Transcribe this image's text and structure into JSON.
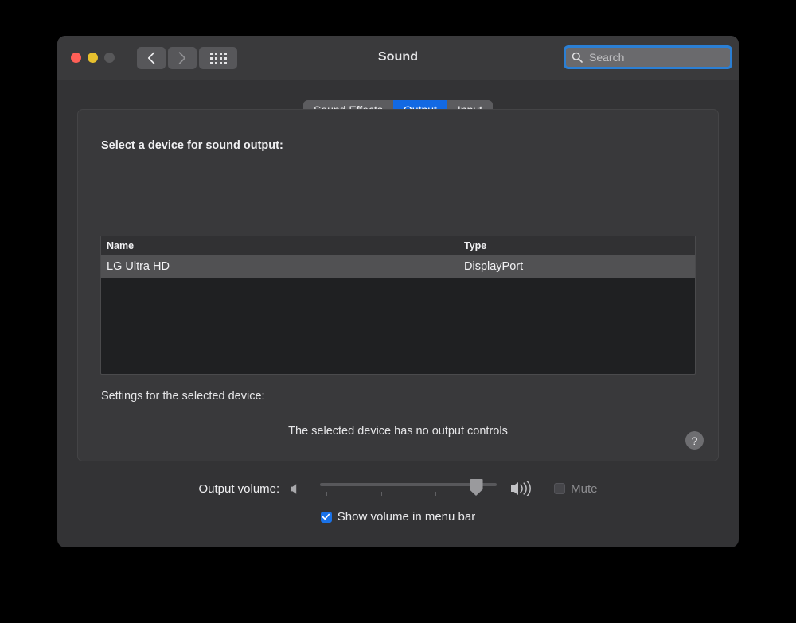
{
  "window": {
    "title": "Sound",
    "traffic_lights": [
      "close",
      "minimize",
      "zoom"
    ],
    "nav": {
      "back": "back-chevron",
      "forward": "forward-chevron",
      "grid": "show-all-grid"
    },
    "search": {
      "placeholder": "Search",
      "value": ""
    }
  },
  "tabs": [
    {
      "label": "Sound Effects",
      "active": false
    },
    {
      "label": "Output",
      "active": true
    },
    {
      "label": "Input",
      "active": false
    }
  ],
  "panel": {
    "heading": "Select a device for sound output:",
    "table": {
      "columns": [
        "Name",
        "Type"
      ],
      "rows": [
        {
          "name": "LG Ultra HD",
          "type": "DisplayPort",
          "selected": true
        }
      ]
    },
    "settings_label": "Settings for the selected device:",
    "settings_message": "The selected device has no output controls",
    "help_button": "?"
  },
  "volume": {
    "label": "Output volume:",
    "slider_value": 88,
    "slider_min": 0,
    "slider_max": 100,
    "tick_count": 4,
    "mute": {
      "label": "Mute",
      "checked": false,
      "enabled": false
    }
  },
  "menubar_option": {
    "label": "Show volume in menu bar",
    "checked": true
  },
  "colors": {
    "accent_blue": "#1269e3",
    "checkbox_blue": "#1a72e8",
    "focus_ring": "#2b7fd4",
    "window_bg": "#333335",
    "panel_bg": "#39393b",
    "table_bg": "#1f2022",
    "row_selected": "#515153"
  }
}
